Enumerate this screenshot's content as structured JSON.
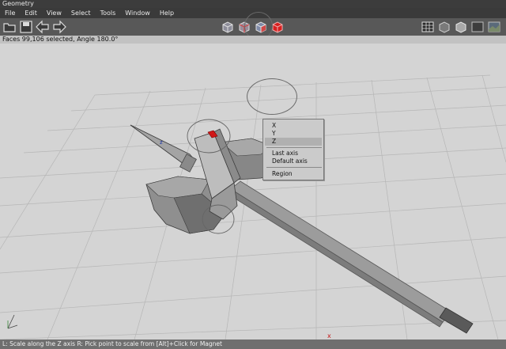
{
  "window": {
    "title": "Geometry"
  },
  "menu": [
    "File",
    "Edit",
    "View",
    "Select",
    "Tools",
    "Window",
    "Help"
  ],
  "toolbar": {
    "left_icons": [
      "open-folder-icon",
      "save-disk-icon",
      "undo-arrow-icon",
      "redo-arrow-icon"
    ],
    "center_icons": [
      "select-vertices-icon",
      "select-edges-icon",
      "select-faces-icon",
      "select-objects-icon"
    ],
    "right_icons": [
      "grid-view-icon",
      "shade-flat-icon",
      "shade-smooth-icon",
      "shade-dark-icon",
      "shade-textured-icon"
    ]
  },
  "status": {
    "selection_text": "Faces 99,106 selected, Angle 180.0°"
  },
  "context_menu": {
    "items": [
      "X",
      "Y",
      "Z",
      "Last axis",
      "Default axis",
      "Region"
    ],
    "selected_index": 2
  },
  "viewport": {
    "axis_labels": {
      "z": "z",
      "x": "x"
    }
  },
  "bottom_status": "L: Scale along the Z axis   R: Pick point to scale from   [Alt]+Click for Magnet",
  "colors": {
    "title_bg": "#3c3c3c",
    "toolbar_bg": "#585858",
    "viewport_bg": "#d4d4d4",
    "selection_red": "#d01818"
  }
}
